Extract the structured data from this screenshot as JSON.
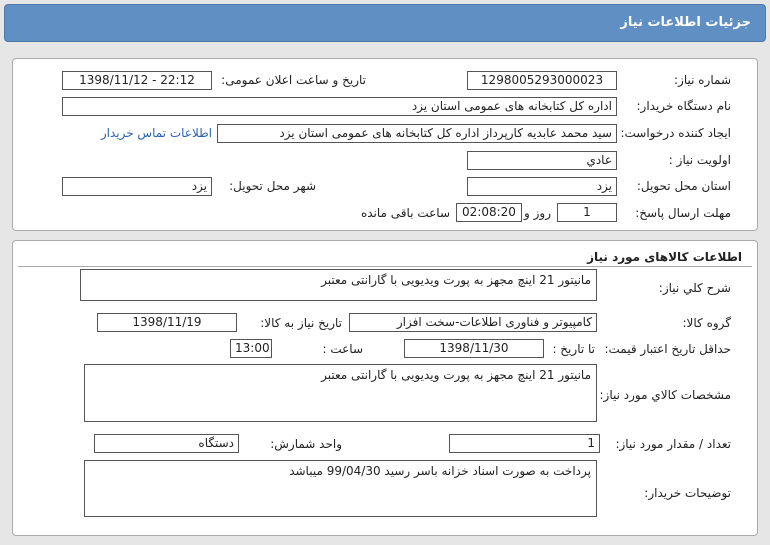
{
  "header": {
    "title": "جزئیات اطلاعات نیاز"
  },
  "need_info": {
    "need_number_label": "شماره نیاز:",
    "need_number": "1298005293000023",
    "announce_datetime_label": "تاریخ و ساعت اعلان عمومی:",
    "announce_datetime": "1398/11/12 - 22:12",
    "buyer_org_label": "نام دستگاه خریدار:",
    "buyer_org": "اداره کل کتابخانه های عمومی استان یزد",
    "requester_label": "ایجاد کننده درخواست:",
    "requester": "سید محمد عابدیه کارپرداز اداره کل کتابخانه های عمومی استان یزد",
    "contact_link": "اطلاعات تماس خریدار",
    "priority_label": "اولویت نیاز :",
    "priority": "عادي",
    "delivery_province_label": "استان محل تحویل:",
    "delivery_province": "یزد",
    "delivery_city_label": "شهر محل تحویل:",
    "delivery_city": "یزد",
    "deadline_label": "مهلت ارسال پاسخ:",
    "deadline_days": "1",
    "days_and_label": "روز و",
    "deadline_time": "02:08:20",
    "remaining_label": "ساعت باقی مانده"
  },
  "goods": {
    "section_title": "اطلاعات کالاهای مورد نیاز",
    "overall_desc_label": "شرح کلي نیاز:",
    "overall_desc": "مانیتور 21 اینچ مجهز به پورت ویدیویی با گارانتی معتبر",
    "goods_group_label": "گروه کالا:",
    "goods_group": "کامپیوتر و فناوری اطلاعات-سخت افزار",
    "need_date_label": "تاریخ نیاز به کالا:",
    "need_date": "1398/11/19",
    "price_validity_label": "حداقل تاریخ اعتبار قیمت:",
    "until_date_label": "تا تاریخ :",
    "until_date": "1398/11/30",
    "time_label": "ساعت :",
    "until_time": "13:00",
    "specs_label": "مشخصات کالاي مورد نیاز:",
    "specs": "مانیتور 21 اینچ مجهز به پورت ویدیویی با گارانتی معتبر",
    "quantity_label": "تعداد / مقدار مورد نیاز:",
    "quantity": "1",
    "unit_label": "واحد شمارش:",
    "unit": "دستگاه",
    "buyer_notes_label": "توضیحات خریدار:",
    "buyer_notes": "پرداخت به صورت اسناد خزانه باسر رسید 99/04/30 میباشد"
  }
}
